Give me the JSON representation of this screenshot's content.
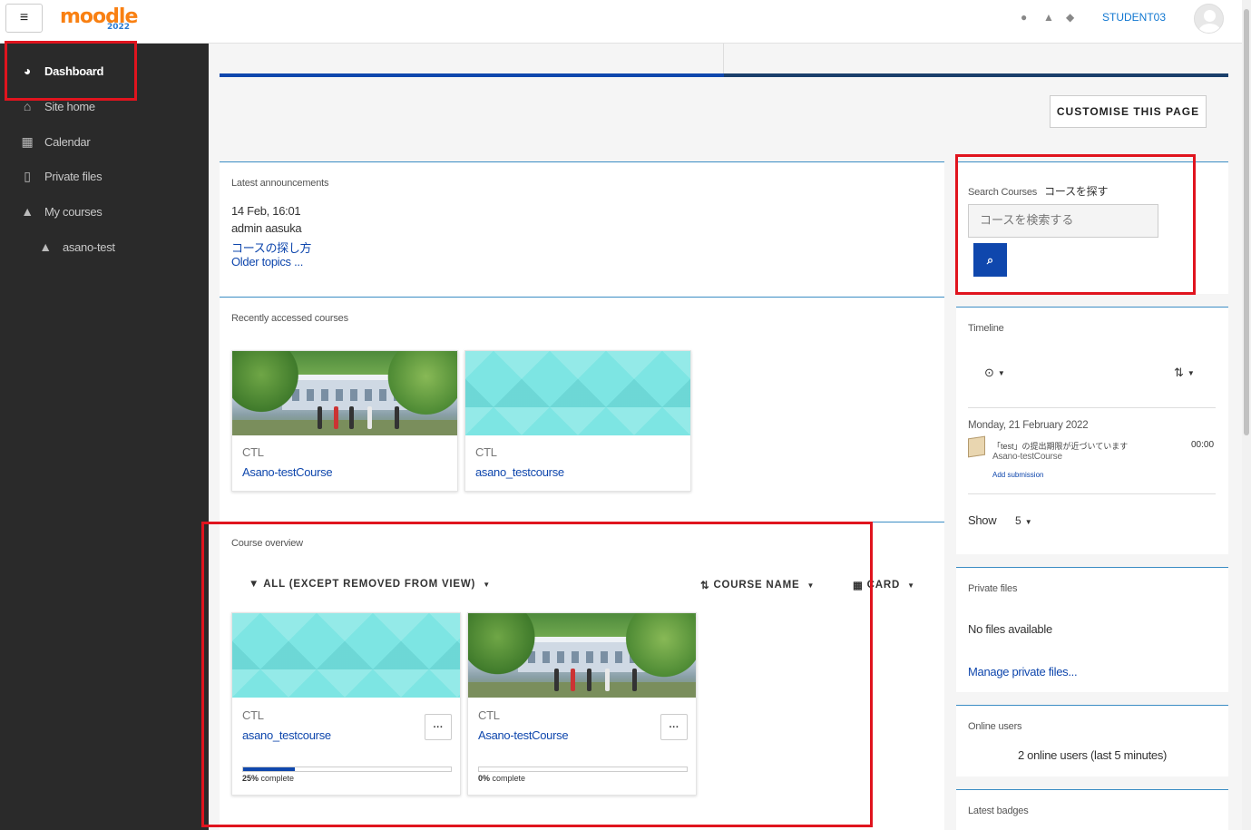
{
  "header": {
    "menu_icon": "hamburger-icon",
    "logo_text": "moodle",
    "logo_year": "2022",
    "icons": [
      "globe-icon",
      "bell-icon",
      "chat-icon"
    ],
    "user_name": "STUDENT03"
  },
  "sidebar": {
    "items": [
      {
        "label": "Dashboard",
        "icon": "dashboard-icon",
        "active": true
      },
      {
        "label": "Site home",
        "icon": "home-icon"
      },
      {
        "label": "Calendar",
        "icon": "calendar-icon"
      },
      {
        "label": "Private files",
        "icon": "file-icon"
      },
      {
        "label": "My courses",
        "icon": "graduation-cap-icon"
      },
      {
        "label": "asano-test",
        "icon": "graduation-cap-icon",
        "sub": true
      }
    ]
  },
  "main": {
    "customise_label": "CUSTOMISE THIS PAGE",
    "announcements": {
      "title": "Latest announcements",
      "date": "14 Feb, 16:01",
      "author": "admin aasuka",
      "link": "コースの探し方",
      "older": "Older topics ..."
    },
    "recent": {
      "title": "Recently accessed courses",
      "courses": [
        {
          "category": "CTL",
          "name": "Asano-testCourse",
          "image": "photo"
        },
        {
          "category": "CTL",
          "name": "asano_testcourse",
          "image": "pattern"
        }
      ]
    },
    "overview": {
      "title": "Course overview",
      "filter_label": "ALL (EXCEPT REMOVED FROM VIEW)",
      "sort_label": "COURSE NAME",
      "view_label": "CARD",
      "more_label": "···",
      "courses": [
        {
          "category": "CTL",
          "name": "asano_testcourse",
          "progress": 25,
          "progress_num": "25%",
          "progress_text": " complete",
          "image": "pattern"
        },
        {
          "category": "CTL",
          "name": "Asano-testCourse",
          "progress": 0,
          "progress_num": "0%",
          "progress_text": " complete",
          "image": "photo"
        }
      ]
    }
  },
  "right": {
    "search": {
      "title": "Search Courses",
      "title_jp": "コースを探す",
      "placeholder": "コースを検索する",
      "button_icon": "search-icon"
    },
    "timeline": {
      "title": "Timeline",
      "date": "Monday, 21 February 2022",
      "event": "「test」の提出期限が近づいています",
      "course": "Asano-testCourse",
      "time": "00:00",
      "action": "Add submission",
      "show_label": "Show",
      "show_value": "5"
    },
    "private_files": {
      "title": "Private files",
      "empty": "No files available",
      "manage": "Manage private files..."
    },
    "online_users": {
      "title": "Online users",
      "text": "2 online users (last 5 minutes)"
    },
    "badges": {
      "title": "Latest badges"
    }
  },
  "colors": {
    "accent": "#0f47ad",
    "sidebar": "#2a2a2a",
    "highlight": "#e0141e"
  }
}
